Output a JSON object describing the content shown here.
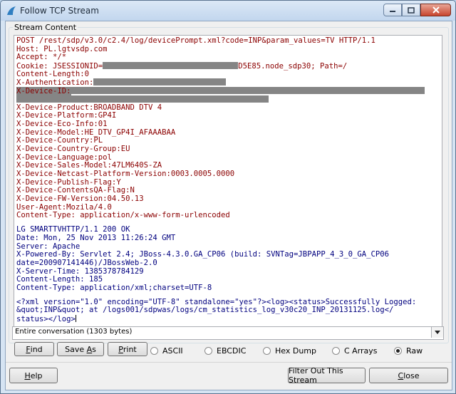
{
  "window": {
    "title": "Follow TCP Stream"
  },
  "group_label": "Stream Content",
  "request_lines": [
    "POST /rest/sdp/v3.0/c2.4/log/devicePrompt.xml?code=INP&param_values=TV HTTP/1.1",
    "Host: PL.lgtvsdp.com",
    "Accept: */*"
  ],
  "cookie": {
    "prefix": "Cookie: JSESSIONID=",
    "suffix": "D5E85.node_sdp30; Path=/"
  },
  "content_length_req": "Content-Length:0",
  "x_auth": "X-Authentication:",
  "x_device_id": "X-Device-ID:",
  "device_lines": [
    "X-Device-Product:BROADBAND DTV 4",
    "X-Device-Platform:GP4I",
    "X-Device-Eco-Info:01",
    "X-Device-Model:HE_DTV_GP4I_AFAAABAA",
    "X-Device-Country:PL",
    "X-Device-Country-Group:EU",
    "X-Device-Language:pol",
    "X-Device-Sales-Model:47LM640S-ZA",
    "X-Device-Netcast-Platform-Version:0003.0005.0000",
    "X-Device-Publish-Flag:Y",
    "X-Device-ContentsQA-Flag:N",
    "X-Device-FW-Version:04.50.13",
    "User-Agent:Mozila/4.0",
    "Content-Type: application/x-www-form-urlencoded"
  ],
  "response_lines": [
    "LG SMARTTVHTTP/1.1 200 OK",
    "Date: Mon, 25 Nov 2013 11:26:24 GMT",
    "Server: Apache",
    "X-Powered-By: Servlet 2.4; JBoss-4.3.0.GA_CP06 (build: SVNTag=JBPAPP_4_3_0_GA_CP06",
    "date=200907141446)/JBossWeb-2.0",
    "X-Server-Time: 1385378784129",
    "Content-Length: 185",
    "Content-Type: application/xml;charset=UTF-8"
  ],
  "xml_lines": [
    "<?xml version=\"1.0\" encoding=\"UTF-8\" standalone=\"yes\"?><log><status>Successfully Logged:",
    "&quot;INP&quot; at /logs001/sdpwas/logs/cm_statistics_log_v30c20_INP_20131125.log</",
    "status></log>"
  ],
  "conversation_select": {
    "selected": "Entire conversation (1303 bytes)"
  },
  "buttons": {
    "find": {
      "u": "F",
      "rest": "ind"
    },
    "save_as": {
      "pre": "Save ",
      "u": "A",
      "rest": "s"
    },
    "print": {
      "u": "P",
      "rest": "rint"
    },
    "help": {
      "u": "H",
      "rest": "elp"
    },
    "filter_out": "Filter Out This Stream",
    "close": {
      "u": "C",
      "rest": "lose"
    }
  },
  "radios": [
    {
      "label": "ASCII",
      "checked": false
    },
    {
      "label": "EBCDIC",
      "checked": false
    },
    {
      "label": "Hex Dump",
      "checked": false
    },
    {
      "label": "C Arrays",
      "checked": false
    },
    {
      "label": "Raw",
      "checked": true
    }
  ],
  "colors": {
    "request": "#8b0000",
    "response": "#00007f",
    "redaction": "#858585"
  }
}
